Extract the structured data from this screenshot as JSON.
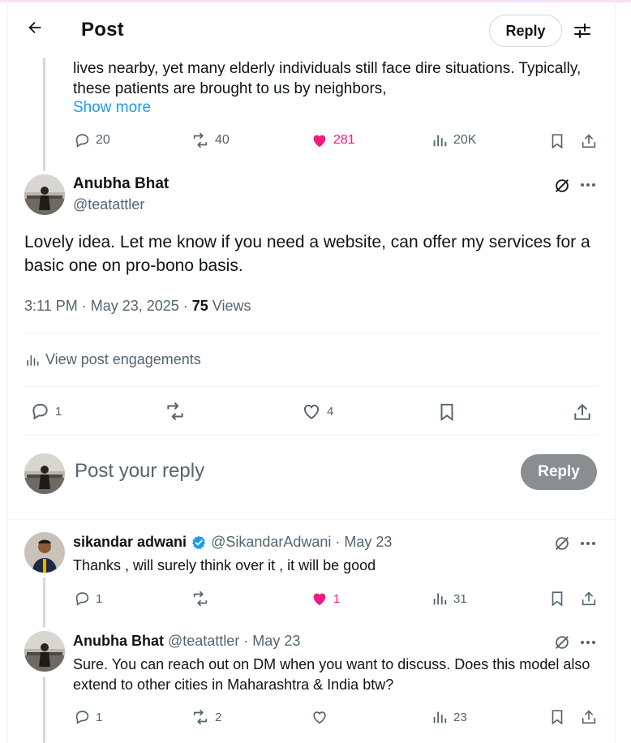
{
  "header": {
    "title": "Post",
    "reply_label": "Reply"
  },
  "parent_post": {
    "text": "lives nearby, yet many elderly individuals still face dire situations. Typically, these patients are brought to us by neighbors,",
    "show_more": "Show more",
    "replies": "20",
    "reposts": "40",
    "likes": "281",
    "views": "20K"
  },
  "main_post": {
    "author_name": "Anubha Bhat",
    "author_handle": "@teatattler",
    "text": "Lovely idea. Let me know if you need a website, can offer my services for a basic one on pro-bono basis.",
    "time": "3:11 PM · May 23, 2025 · ",
    "views_count": "75",
    "views_label": " Views",
    "engagements_label": "View post engagements",
    "replies": "1",
    "reposts": "",
    "likes": "4"
  },
  "composer": {
    "placeholder": "Post your reply",
    "reply_label": "Reply"
  },
  "replies": [
    {
      "author_name": "sikandar adwani",
      "author_handle": "@SikandarAdwani",
      "date": "· May 23",
      "text": "Thanks , will surely think over it , it will be good",
      "replies": "1",
      "reposts": "",
      "likes": "1",
      "views": "31",
      "verified": true
    },
    {
      "author_name": "Anubha Bhat",
      "author_handle": "@teatattler",
      "date": "· May 23",
      "text": "Sure. You can reach out on DM when you want to discuss. Does this model also extend to other cities in Maharashtra & India btw?",
      "replies": "1",
      "reposts": "2",
      "likes": "",
      "views": "23",
      "verified": false
    }
  ],
  "colors": {
    "accent": "#1d9bf0",
    "like": "#f91880",
    "muted": "#536471",
    "reply_button_disabled": "#8b8e91"
  }
}
